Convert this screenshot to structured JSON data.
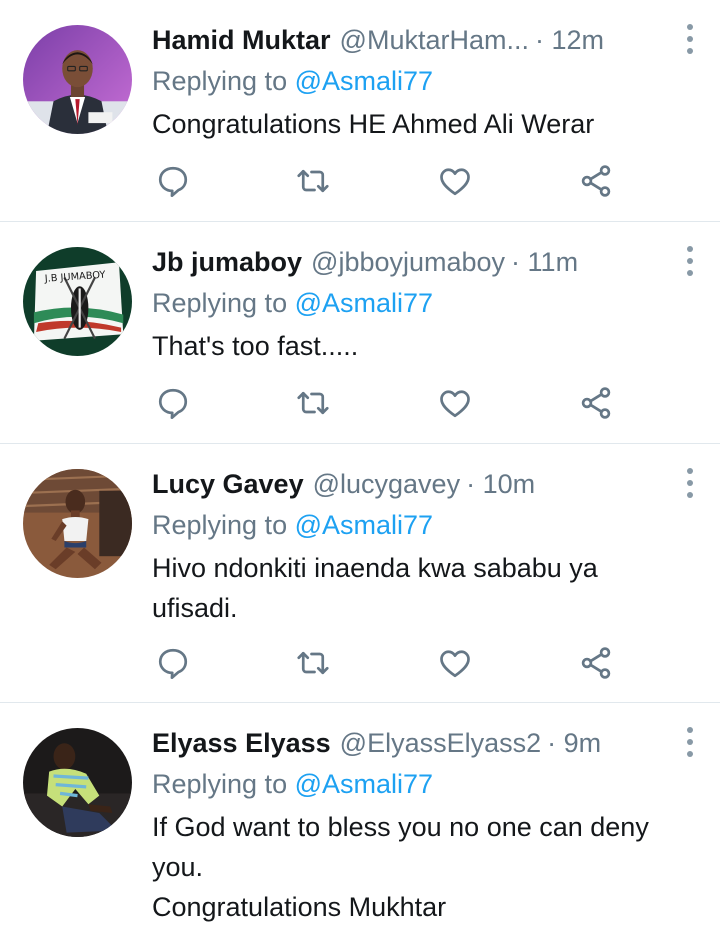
{
  "colors": {
    "name": "#14171a",
    "secondary": "#657786",
    "link": "#1da1f2",
    "icon": "#657786",
    "divider": "#e1e8ed"
  },
  "tweets": [
    {
      "name": "Hamid Muktar",
      "handle": "@MuktarHam...",
      "time": "· 12m",
      "replying_prefix": "Replying to ",
      "replying_to": "@Asmali77",
      "text": "Congratulations HE Ahmed Ali Werar",
      "avatar": "avatar-man-in-suit"
    },
    {
      "name": "Jb jumaboy",
      "handle": "@jbboyjumaboy",
      "time": "· 11m",
      "replying_prefix": "Replying to ",
      "replying_to": "@Asmali77",
      "text": "That's too fast.....",
      "avatar": "avatar-jb-jumaboy-logo",
      "avatar_text": "J.B JUMABOY"
    },
    {
      "name": "Lucy Gavey",
      "handle": "@lucygavey",
      "time": "· 10m",
      "replying_prefix": "Replying to ",
      "replying_to": "@Asmali77",
      "text": "Hivo ndonkiti inaenda kwa sababu ya\nufisadi.",
      "avatar": "avatar-woman-seated"
    },
    {
      "name": "Elyass Elyass",
      "handle": "@ElyassElyass2",
      "time": "· 9m",
      "replying_prefix": "Replying to ",
      "replying_to": "@Asmali77",
      "text": "If God want to bless you no one can deny\nyou.\nCongratulations Mukhtar",
      "avatar": "avatar-man-plaid-shirt"
    }
  ],
  "icons": [
    "reply-icon",
    "retweet-icon",
    "like-icon",
    "share-icon",
    "more-options-icon"
  ]
}
